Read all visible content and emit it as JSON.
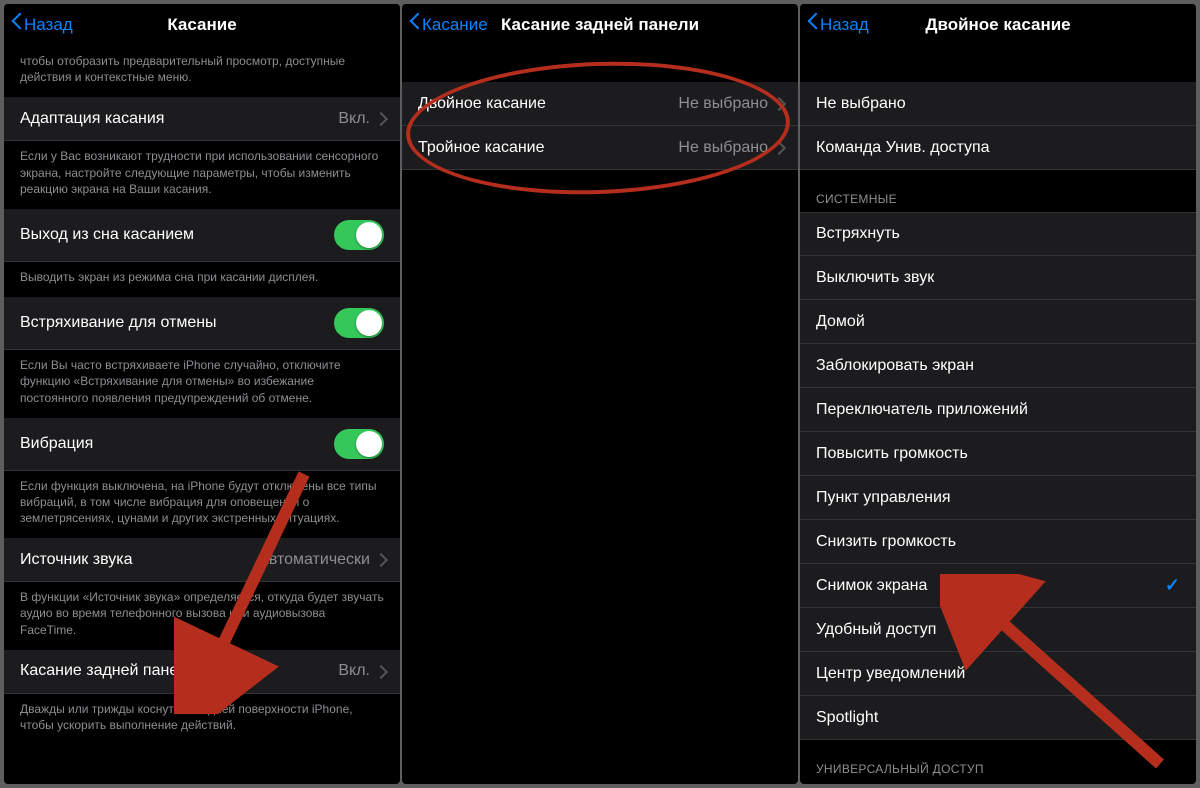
{
  "pane1": {
    "back": "Назад",
    "title": "Касание",
    "topFooter": "чтобы отобразить предварительный просмотр, доступные действия и контекстные меню.",
    "row_adapt": {
      "label": "Адаптация касания",
      "value": "Вкл."
    },
    "adapt_footer": "Если у Вас возникают трудности при использовании сенсорного экрана, настройте следующие параметры, чтобы изменить реакцию экрана на Ваши касания.",
    "row_wake": {
      "label": "Выход из сна касанием"
    },
    "wake_footer": "Выводить экран из режима сна при касании дисплея.",
    "row_shake": {
      "label": "Встряхивание для отмены"
    },
    "shake_footer": "Если Вы часто встряхиваете iPhone случайно, отключите функцию «Встряхивание для отмены» во избежание постоянного появления предупреждений об отмене.",
    "row_vibro": {
      "label": "Вибрация"
    },
    "vibro_footer": "Если функция выключена, на iPhone будут отключены все типы вибраций, в том числе вибрация для оповещений о землетрясениях, цунами и других экстренных ситуациях.",
    "row_audio": {
      "label": "Источник звука",
      "value": "Автоматически"
    },
    "audio_footer": "В функции «Источник звука» определяется, откуда будет звучать аудио во время телефонного вызова или аудиовызова FaceTime.",
    "row_backtap": {
      "label": "Касание задней панели",
      "value": "Вкл."
    },
    "backtap_footer": "Дважды или трижды коснуться задней поверхности iPhone, чтобы ускорить выполнение действий."
  },
  "pane2": {
    "back": "Касание",
    "title": "Касание задней панели",
    "row_double": {
      "label": "Двойное касание",
      "value": "Не выбрано"
    },
    "row_triple": {
      "label": "Тройное касание",
      "value": "Не выбрано"
    }
  },
  "pane3": {
    "back": "Назад",
    "title": "Двойное касание",
    "row_none": "Не выбрано",
    "row_ua_cmd": "Команда Унив. доступа",
    "section_system": "СИСТЕМНЫЕ",
    "sys_items": [
      "Встряхнуть",
      "Выключить звук",
      "Домой",
      "Заблокировать экран",
      "Переключатель приложений",
      "Повысить громкость",
      "Пункт управления",
      "Снизить громкость",
      "Снимок экрана",
      "Удобный доступ",
      "Центр уведомлений",
      "Spotlight"
    ],
    "selected_index": 8,
    "section_ua": "УНИВЕРСАЛЬНЫЙ ДОСТУП"
  }
}
